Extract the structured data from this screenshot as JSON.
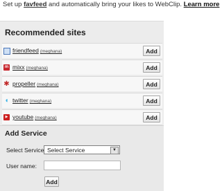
{
  "intro": {
    "prefix": "Set up",
    "fav_link": "favfeed",
    "middle": "and automatically bring your likes to WebClip.",
    "learn_more": "Learn more"
  },
  "recommended": {
    "title": "Recommended sites",
    "add_label": "Add",
    "sites": [
      {
        "name": "friendfeed",
        "user": "(meghana)",
        "icon": "friendfeed-icon"
      },
      {
        "name": "mixx",
        "user": "(meghana)",
        "icon": "mixx-icon"
      },
      {
        "name": "propeller",
        "user": "(meghana)",
        "icon": "propeller-icon"
      },
      {
        "name": "twitter",
        "user": "(meghana)",
        "icon": "twitter-icon"
      },
      {
        "name": "youtube",
        "user": "(meghana)",
        "icon": "youtube-icon"
      }
    ]
  },
  "add_service": {
    "title": "Add Service",
    "service_label": "Select Service:",
    "service_selected": "Select Service",
    "username_label": "User name:",
    "username_value": "",
    "add_label": "Add"
  }
}
